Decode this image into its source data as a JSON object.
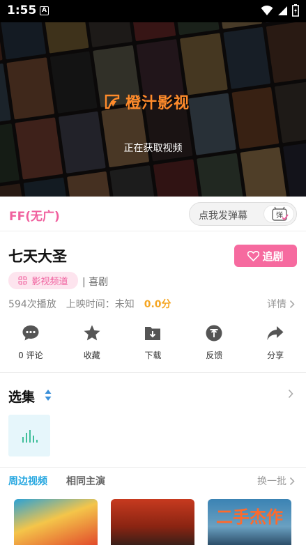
{
  "status_bar": {
    "time": "1:55",
    "notification_badge": "A"
  },
  "player": {
    "brand_name": "橙汁影视",
    "loading_text": "正在获取视频",
    "brand_color": "#ff8b2b"
  },
  "source_bar": {
    "source_label": "FF(无广)",
    "danmu_placeholder": "点我发弹幕",
    "danmu_button_label": "弹"
  },
  "show": {
    "title": "七天大圣",
    "follow_label": "追剧",
    "channel_tag": "影视频道",
    "genre": "| 喜剧",
    "play_count": "594次播放",
    "release_time": "上映时间：未知",
    "score": "0.0分",
    "details_label": "详情"
  },
  "actions": [
    {
      "label": "0 评论",
      "icon": "comment-icon"
    },
    {
      "label": "收藏",
      "icon": "star-icon"
    },
    {
      "label": "下载",
      "icon": "download-icon"
    },
    {
      "label": "反馈",
      "icon": "feedback-icon"
    },
    {
      "label": "分享",
      "icon": "share-icon"
    }
  ],
  "episodes": {
    "title": "选集"
  },
  "related": {
    "tabs": [
      "周边视频",
      "相同主演"
    ],
    "refresh_label": "换一批",
    "thumb_caption_3": "二手杰作"
  },
  "colors": {
    "accent_pink": "#f66a9f",
    "accent_blue": "#26a7e0",
    "score_orange": "#f5a623"
  }
}
